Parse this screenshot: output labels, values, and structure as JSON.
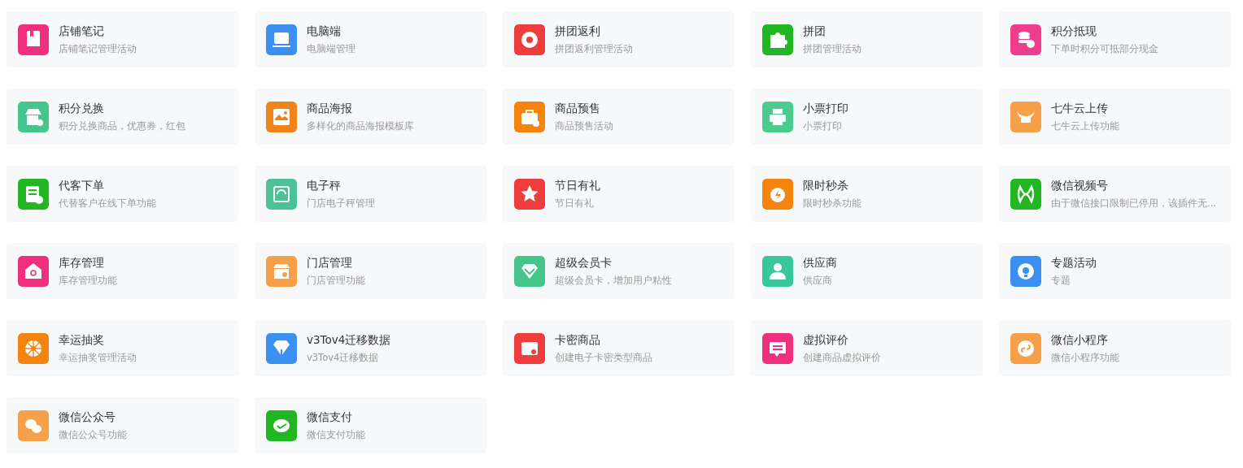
{
  "plugins": [
    {
      "title": "店铺笔记",
      "description": "店铺笔记管理活动",
      "color": "#f0307f"
    },
    {
      "title": "电脑端",
      "description": "电脑端管理",
      "color": "#3b8ff0"
    },
    {
      "title": "拼团返利",
      "description": "拼团返利管理活动",
      "color": "#ef3c3c"
    },
    {
      "title": "拼团",
      "description": "拼团管理活动",
      "color": "#22b722"
    },
    {
      "title": "积分抵现",
      "description": "下单时积分可抵部分现金",
      "color": "#f03c8c"
    },
    {
      "title": "积分兑换",
      "description": "积分兑换商品，优惠券，红包",
      "color": "#45c48c"
    },
    {
      "title": "商品海报",
      "description": "多样化的商品海报模板库",
      "color": "#f0841a"
    },
    {
      "title": "商品预售",
      "description": "商品预售活动",
      "color": "#f5840f"
    },
    {
      "title": "小票打印",
      "description": "小票打印",
      "color": "#4ccb8e"
    },
    {
      "title": "七牛云上传",
      "description": "七牛云上传功能",
      "color": "#f7a04a"
    },
    {
      "title": "代客下单",
      "description": "代替客户在线下单功能",
      "color": "#22b722"
    },
    {
      "title": "电子秤",
      "description": "门店电子秤管理",
      "color": "#4cc197"
    },
    {
      "title": "节日有礼",
      "description": "节日有礼",
      "color": "#ef3c3c"
    },
    {
      "title": "限时秒杀",
      "description": "限时秒杀功能",
      "color": "#f5840f"
    },
    {
      "title": "微信视频号",
      "description": "由于微信接口限制已停用，该插件无...",
      "color": "#22b722"
    },
    {
      "title": "库存管理",
      "description": "库存管理功能",
      "color": "#f0307f"
    },
    {
      "title": "门店管理",
      "description": "门店管理功能",
      "color": "#f7a04a"
    },
    {
      "title": "超级会员卡",
      "description": "超级会员卡，增加用户粘性",
      "color": "#45c48c"
    },
    {
      "title": "供应商",
      "description": "供应商",
      "color": "#38c79a"
    },
    {
      "title": "专题活动",
      "description": "专题",
      "color": "#3b8ff0"
    },
    {
      "title": "幸运抽奖",
      "description": "幸运抽奖管理活动",
      "color": "#f5840f"
    },
    {
      "title": "v3Tov4迁移数据",
      "description": "v3Tov4迁移数据",
      "color": "#3b8ff0"
    },
    {
      "title": "卡密商品",
      "description": "创建电子卡密类型商品",
      "color": "#ef3c3c"
    },
    {
      "title": "虚拟评价",
      "description": "创建商品虚拟评价",
      "color": "#f0307f"
    },
    {
      "title": "微信小程序",
      "description": "微信小程序功能",
      "color": "#f7a04a"
    },
    {
      "title": "微信公众号",
      "description": "微信公众号功能",
      "color": "#f7a04a"
    },
    {
      "title": "微信支付",
      "description": "微信支付功能",
      "color": "#22b722"
    }
  ]
}
